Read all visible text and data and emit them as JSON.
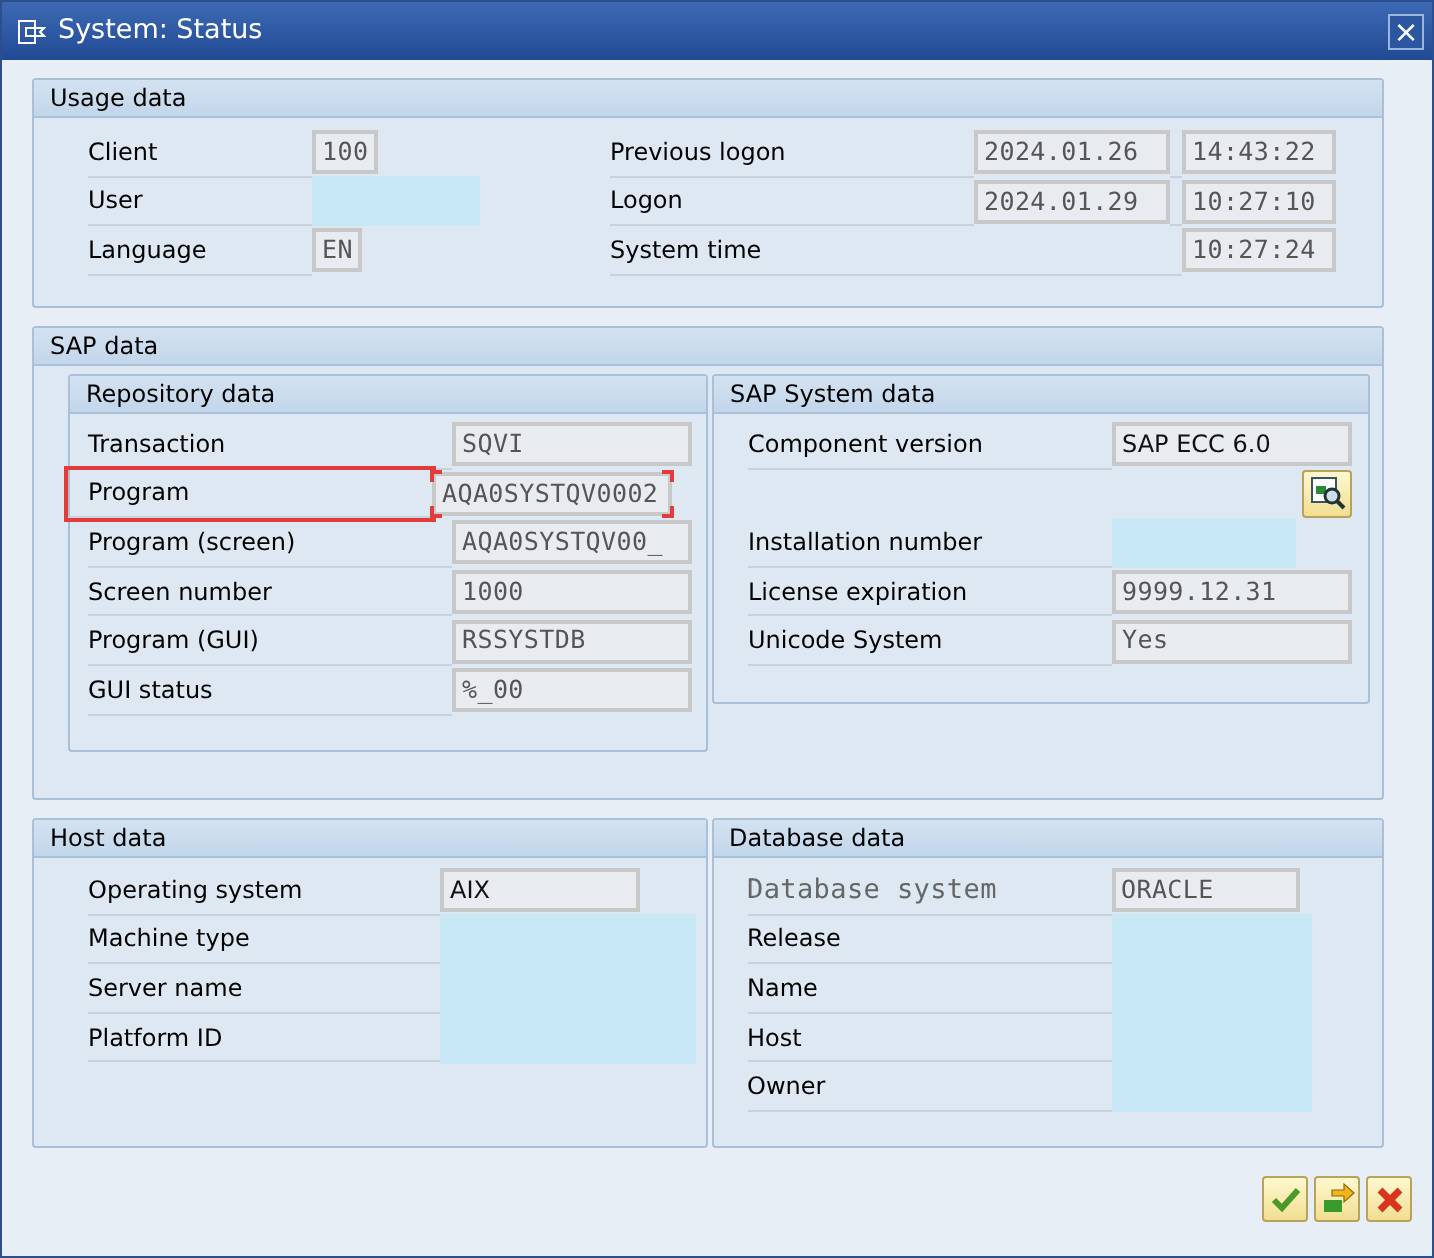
{
  "window": {
    "title": "System: Status",
    "close": "×"
  },
  "usage": {
    "title": "Usage data",
    "left": [
      {
        "label": "Client",
        "value": "100",
        "redacted": false
      },
      {
        "label": "User",
        "redacted": true
      },
      {
        "label": "Language",
        "value": "EN",
        "redacted": false
      }
    ],
    "right": [
      {
        "label": "Previous logon",
        "date": "2024.01.26",
        "time": "14:43:22"
      },
      {
        "label": "Logon",
        "date": "2024.01.29",
        "time": "10:27:10"
      },
      {
        "label": "System time",
        "time": "10:27:24"
      }
    ]
  },
  "sap": {
    "title": "SAP data",
    "repository": {
      "title": "Repository data",
      "rows": [
        {
          "label": "Transaction",
          "value": "SQVI",
          "kind": "mono",
          "highlighted": false,
          "redacted": false
        },
        {
          "label": "Program",
          "value": "AQA0SYSTQV0002",
          "kind": "mono",
          "highlighted": true,
          "redacted": false
        },
        {
          "label": "Program (screen)",
          "value": "AQA0SYSTQV00_",
          "kind": "mono",
          "highlighted": false,
          "redacted": false
        },
        {
          "label": "Screen number",
          "value": "1000",
          "kind": "mono",
          "highlighted": false,
          "redacted": false
        },
        {
          "label": "Program (GUI)",
          "value": "RSSYSTDB",
          "kind": "mono",
          "highlighted": false,
          "redacted": false
        },
        {
          "label": "GUI status",
          "value": "%_00",
          "kind": "mono",
          "highlighted": false,
          "redacted": false
        }
      ]
    },
    "system": {
      "title": "SAP System data",
      "rows": [
        {
          "label": "Component version",
          "value": "SAP ECC 6.0",
          "kind": "text",
          "redacted": false
        },
        {
          "kind": "detail-button"
        },
        {
          "label": "Installation number",
          "kind": "mono",
          "redacted": true
        },
        {
          "label": "License expiration",
          "value": "9999.12.31",
          "kind": "mono",
          "redacted": false
        },
        {
          "label": "Unicode System",
          "value": "Yes",
          "kind": "mono",
          "redacted": false
        }
      ]
    }
  },
  "host": {
    "title": "Host data",
    "rows": [
      {
        "label": "Operating system",
        "value": "AIX",
        "kind": "text",
        "redacted": false
      },
      {
        "label": "Machine type",
        "redacted": true
      },
      {
        "label": "Server name",
        "redacted": true
      },
      {
        "label": "Platform ID",
        "redacted": true
      }
    ]
  },
  "database": {
    "title": "Database data",
    "rows": [
      {
        "label": "Database system",
        "greyed": true,
        "value": "ORACLE",
        "kind": "mono",
        "redacted": false
      },
      {
        "label": "Release",
        "greyed": false,
        "redacted": true
      },
      {
        "label": "Name",
        "greyed": false,
        "redacted": true
      },
      {
        "label": "Host",
        "greyed": false,
        "redacted": true
      },
      {
        "label": "Owner",
        "greyed": false,
        "redacted": true
      }
    ]
  },
  "buttons": [
    {
      "kind": "check"
    },
    {
      "kind": "transfer"
    },
    {
      "kind": "cancel"
    }
  ]
}
